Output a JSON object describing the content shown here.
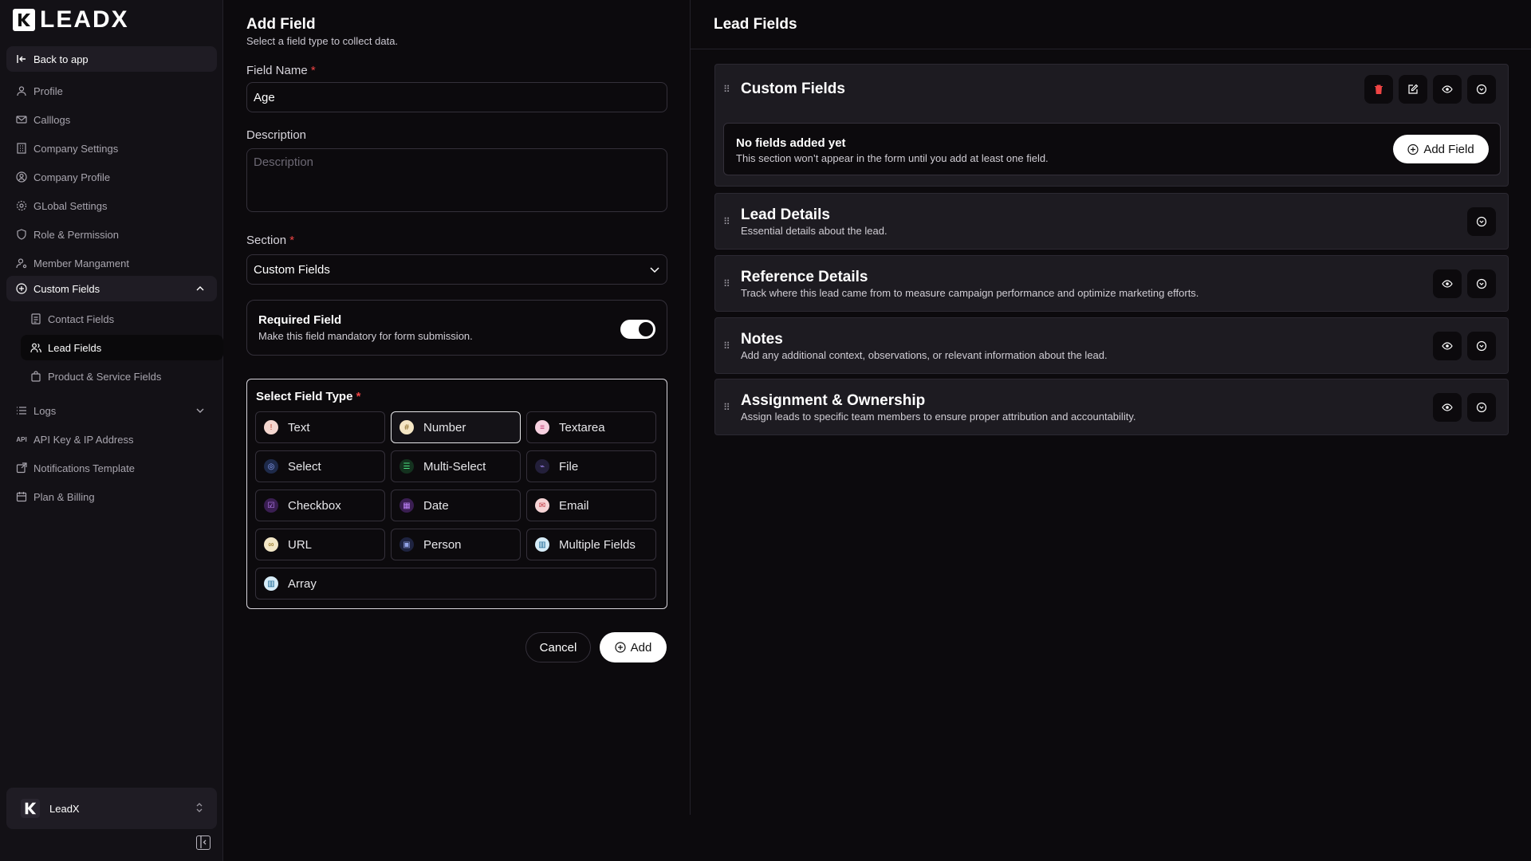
{
  "brand": {
    "name": "LEADX"
  },
  "sidebar": {
    "back": "Back to app",
    "items": [
      {
        "label": "Profile",
        "icon": "user-icon"
      },
      {
        "label": "Calllogs",
        "icon": "mail-icon"
      },
      {
        "label": "Company Settings",
        "icon": "building-icon"
      },
      {
        "label": "Company Profile",
        "icon": "user-circle-icon"
      },
      {
        "label": "GLobal Settings",
        "icon": "gear-icon"
      },
      {
        "label": "Role & Permission",
        "icon": "shield-icon"
      },
      {
        "label": "Member Mangament",
        "icon": "user-cog-icon"
      },
      {
        "label": "Custom Fields",
        "icon": "plus-circle-icon"
      },
      {
        "label": "Contact Fields",
        "icon": "contact-card-icon"
      },
      {
        "label": "Lead Fields",
        "icon": "users-icon"
      },
      {
        "label": "Product & Service Fields",
        "icon": "bag-icon"
      },
      {
        "label": "Logs",
        "icon": "list-icon"
      },
      {
        "label": "API Key & IP Address",
        "icon": "api-icon"
      },
      {
        "label": "Notifications Template",
        "icon": "template-icon"
      },
      {
        "label": "Plan & Billing",
        "icon": "calendar-icon"
      }
    ],
    "workspace": "LeadX"
  },
  "add_field": {
    "title": "Add Field",
    "subtitle": "Select a field type to collect data.",
    "name_label": "Field Name",
    "name_value": "Age",
    "desc_label": "Description",
    "desc_placeholder": "Description",
    "section_label": "Section",
    "section_value": "Custom Fields",
    "required_title": "Required Field",
    "required_sub": "Make this field mandatory for form submission.",
    "required_on": true,
    "type_title": "Select Field Type",
    "types": [
      {
        "label": "Text",
        "color": "#f4d6cf",
        "fg": "#c0442d",
        "glyph": "!"
      },
      {
        "label": "Number",
        "color": "#f5e6c4",
        "fg": "#7a5a12",
        "glyph": "#",
        "selected": true
      },
      {
        "label": "Textarea",
        "color": "#f7d1e0",
        "fg": "#c23a74",
        "glyph": "≡"
      },
      {
        "label": "Select",
        "color": "#1e2a4a",
        "fg": "#8fa6ff",
        "glyph": "◎"
      },
      {
        "label": "Multi-Select",
        "color": "#14321f",
        "fg": "#4ade80",
        "glyph": "☰"
      },
      {
        "label": "File",
        "color": "#231f3a",
        "fg": "#a78bfa",
        "glyph": "⌁"
      },
      {
        "label": "Checkbox",
        "color": "#3a1e52",
        "fg": "#c084fc",
        "glyph": "☑"
      },
      {
        "label": "Date",
        "color": "#3a1e52",
        "fg": "#c084fc",
        "glyph": "▦"
      },
      {
        "label": "Email",
        "color": "#f6d4d6",
        "fg": "#c0343f",
        "glyph": "✉"
      },
      {
        "label": "URL",
        "color": "#f3e7c7",
        "fg": "#8a6a10",
        "glyph": "∞"
      },
      {
        "label": "Person",
        "color": "#1e2340",
        "fg": "#93a4e8",
        "glyph": "▣"
      },
      {
        "label": "Multiple Fields",
        "color": "#d6ecf8",
        "fg": "#0f5f8c",
        "glyph": "▥"
      },
      {
        "label": "Array",
        "color": "#d6ecf8",
        "fg": "#0f5f8c",
        "glyph": "▥"
      }
    ],
    "cancel": "Cancel",
    "add": "Add"
  },
  "lead_fields": {
    "title": "Lead Fields",
    "sections": [
      {
        "title": "Custom Fields",
        "subtitle": ""
      },
      {
        "title": "Lead Details",
        "subtitle": "Essential details about the lead."
      },
      {
        "title": "Reference Details",
        "subtitle": "Track where this lead came from to measure campaign performance and optimize marketing efforts."
      },
      {
        "title": "Notes",
        "subtitle": "Add any additional context, observations, or relevant information about the lead."
      },
      {
        "title": "Assignment & Ownership",
        "subtitle": "Assign leads to specific team members to ensure proper attribution and accountability."
      }
    ],
    "empty_title": "No fields added yet",
    "empty_sub": "This section won’t appear in the form until you add at least one field.",
    "add_field": "Add Field"
  },
  "colors": {
    "danger": "#ef4444",
    "accent": "#ffffff",
    "background": "#0c0a0d"
  }
}
